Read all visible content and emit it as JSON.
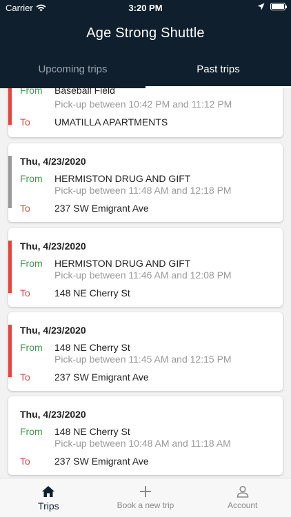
{
  "status": {
    "carrier": "Carrier",
    "time": "3:20 PM"
  },
  "header": {
    "title": "Age Strong Shuttle"
  },
  "tabs": [
    {
      "label": "Upcoming trips",
      "active": false
    },
    {
      "label": "Past trips",
      "active": true
    }
  ],
  "labels": {
    "from": "From",
    "to": "To"
  },
  "colors": {
    "green": "#3b9a4b",
    "red": "#e5453a",
    "gray": "#9a9a9a",
    "navy": "#0f1f2e"
  },
  "trips": [
    {
      "date": "",
      "from": "Baseball Field",
      "pickup": "Pick-up between 10:42 PM and 11:12 PM",
      "to": "UMATILLA APARTMENTS",
      "status_color": "#e5453a"
    },
    {
      "date": "Thu, 4/23/2020",
      "from": "HERMISTON DRUG AND GIFT",
      "pickup": "Pick-up between 11:48 AM and 12:18 PM",
      "to": "237 SW Emigrant Ave",
      "status_color": "#9a9a9a"
    },
    {
      "date": "Thu, 4/23/2020",
      "from": "HERMISTON DRUG AND GIFT",
      "pickup": "Pick-up between 11:46 AM and 12:08 PM",
      "to": "148 NE Cherry St",
      "status_color": "#e5453a"
    },
    {
      "date": "Thu, 4/23/2020",
      "from": "148 NE Cherry St",
      "pickup": "Pick-up between 11:45 AM and 12:15 PM",
      "to": "237 SW Emigrant Ave",
      "status_color": "#e5453a"
    },
    {
      "date": "Thu, 4/23/2020",
      "from": "148 NE Cherry St",
      "pickup": "Pick-up between 10:48 AM and 11:18 AM",
      "to": "237 SW Emigrant Ave",
      "status_color": ""
    }
  ],
  "bottom_nav": [
    {
      "label": "Trips",
      "icon": "home-icon",
      "active": true
    },
    {
      "label": "Book a new trip",
      "icon": "plus-icon",
      "active": false
    },
    {
      "label": "Account",
      "icon": "account-icon",
      "active": false
    }
  ]
}
